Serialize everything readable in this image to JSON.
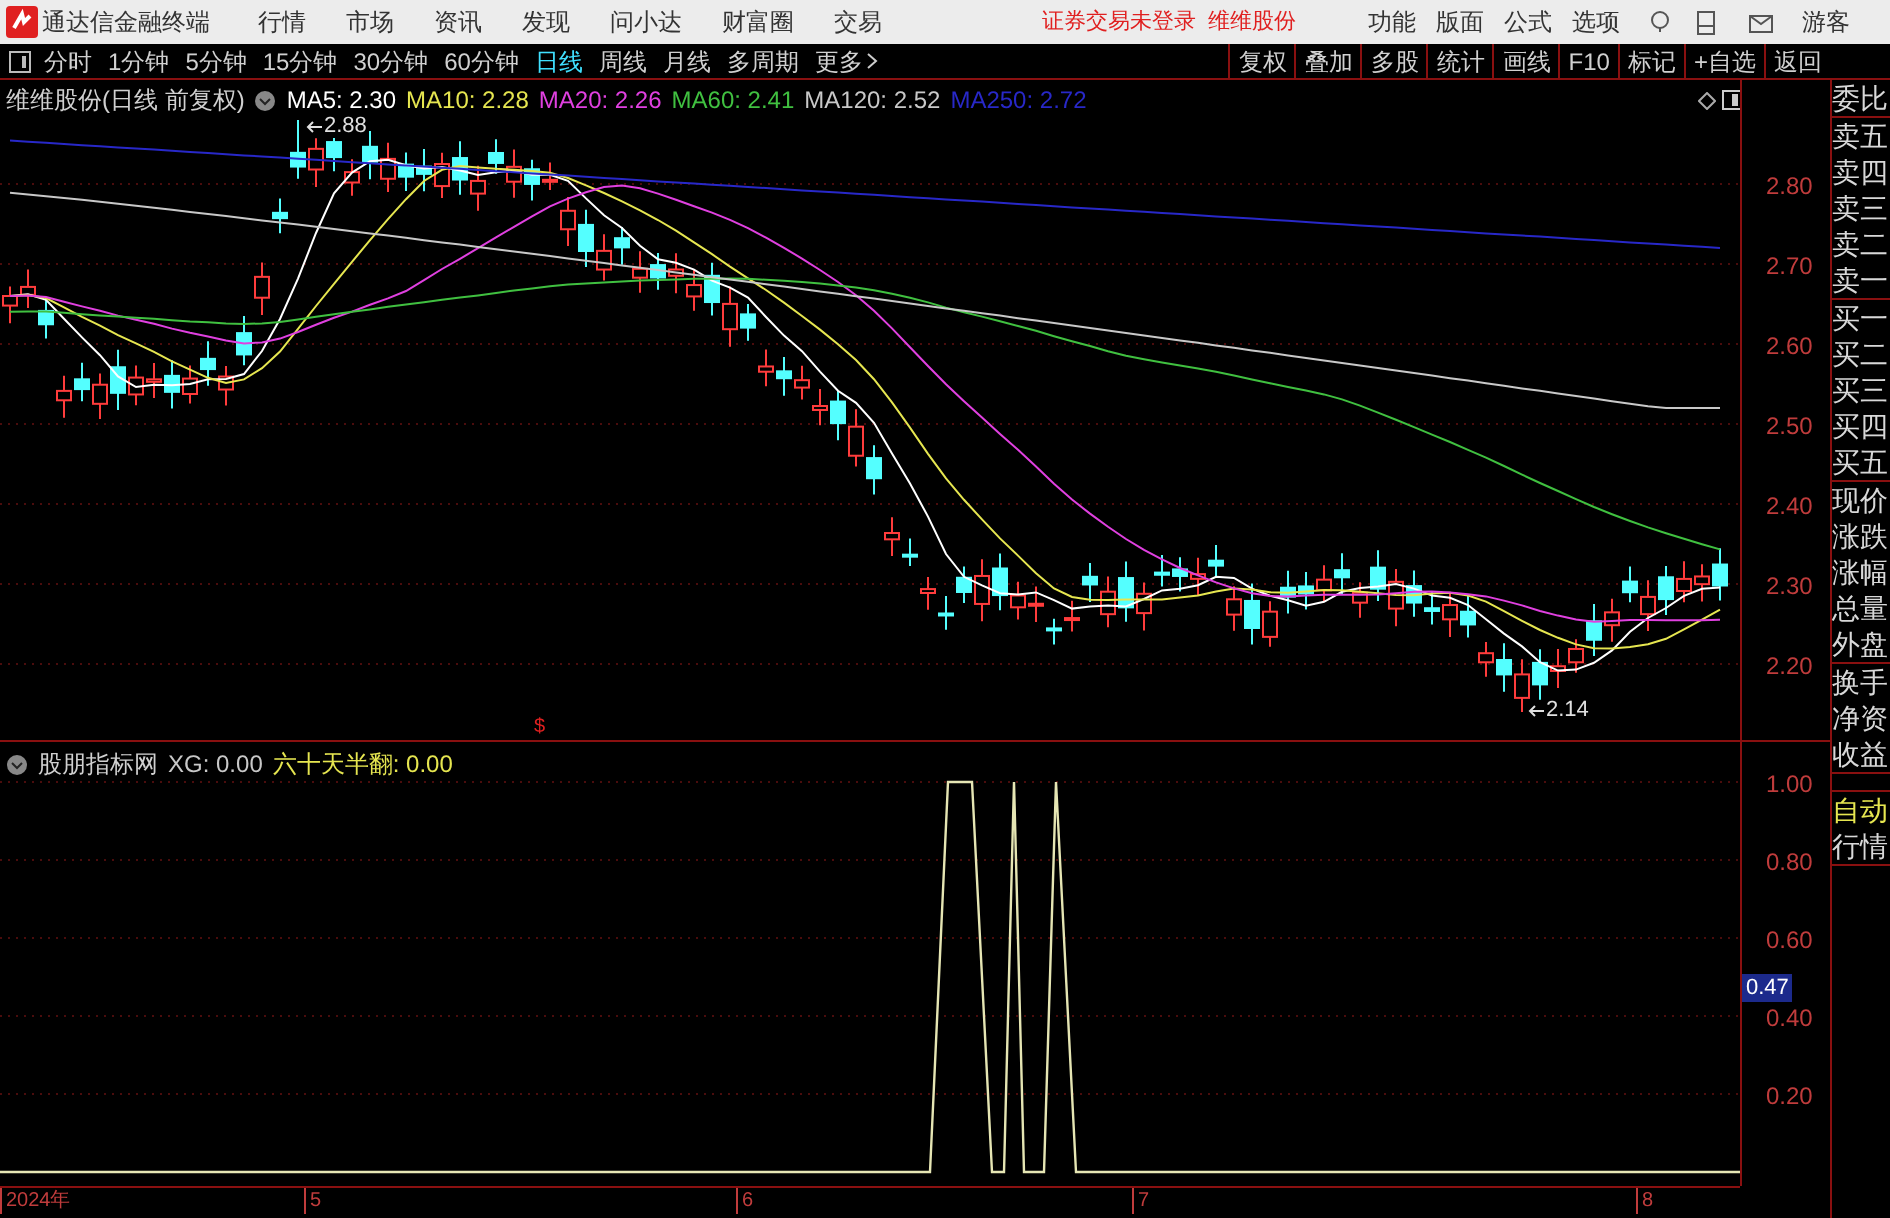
{
  "app": {
    "title": "通达信金融终端",
    "menus": [
      "行情",
      "市场",
      "资讯",
      "发现",
      "问小达",
      "财富圈",
      "交易"
    ],
    "status": "证券交易未登录",
    "stock": "维维股份",
    "right_menus": [
      "功能",
      "版面",
      "公式",
      "选项"
    ],
    "user": "游客"
  },
  "periods": [
    {
      "label": "分时",
      "selected": false
    },
    {
      "label": "1分钟",
      "selected": false
    },
    {
      "label": "5分钟",
      "selected": false
    },
    {
      "label": "15分钟",
      "selected": false
    },
    {
      "label": "30分钟",
      "selected": false
    },
    {
      "label": "60分钟",
      "selected": false
    },
    {
      "label": "日线",
      "selected": true
    },
    {
      "label": "周线",
      "selected": false
    },
    {
      "label": "月线",
      "selected": false
    },
    {
      "label": "多周期",
      "selected": false
    }
  ],
  "more": "更多",
  "tools": [
    "复权",
    "叠加",
    "多股",
    "统计",
    "画线",
    "F10",
    "标记",
    "+自选",
    "返回"
  ],
  "main_chart": {
    "title": "维维股份(日线 前复权)",
    "ma": [
      {
        "label": "MA5: 2.30",
        "color": "#ffffff"
      },
      {
        "label": "MA10: 2.28",
        "color": "#e6e650"
      },
      {
        "label": "MA20: 2.26",
        "color": "#e040e0"
      },
      {
        "label": "MA60: 2.41",
        "color": "#40c040"
      },
      {
        "label": "MA120: 2.52",
        "color": "#c8c8c8"
      },
      {
        "label": "MA250: 2.72",
        "color": "#2828c8"
      }
    ],
    "high_label": "2.88",
    "low_label": "2.14",
    "event_mark": "$",
    "price_ticks": [
      "2.80",
      "2.70",
      "2.60",
      "2.50",
      "2.40",
      "2.30",
      "2.20"
    ]
  },
  "indicator": {
    "name": "股朋指标网",
    "values": [
      {
        "label": "XG: 0.00",
        "color": "#c8c8c8"
      },
      {
        "label": "六十天半翻: 0.00",
        "color": "#e6e650"
      }
    ],
    "ticks": [
      "1.00",
      "0.80",
      "0.60",
      "0.40",
      "0.20"
    ],
    "current": "0.47"
  },
  "x_axis": [
    "2024年",
    "5",
    "6",
    "7",
    "8"
  ],
  "sidebar": {
    "groups": [
      [
        "委比"
      ],
      [
        "卖五",
        "卖四",
        "卖三",
        "卖二",
        "卖一"
      ],
      [
        "买一",
        "买二",
        "买三",
        "买四",
        "买五"
      ],
      [
        "现价",
        "涨跌",
        "涨幅",
        "总量",
        "外盘"
      ],
      [
        "换手",
        "净资",
        "收益"
      ]
    ],
    "modes": [
      {
        "label": "自动",
        "selected": true
      },
      {
        "label": "行情",
        "selected": false
      }
    ]
  }
}
